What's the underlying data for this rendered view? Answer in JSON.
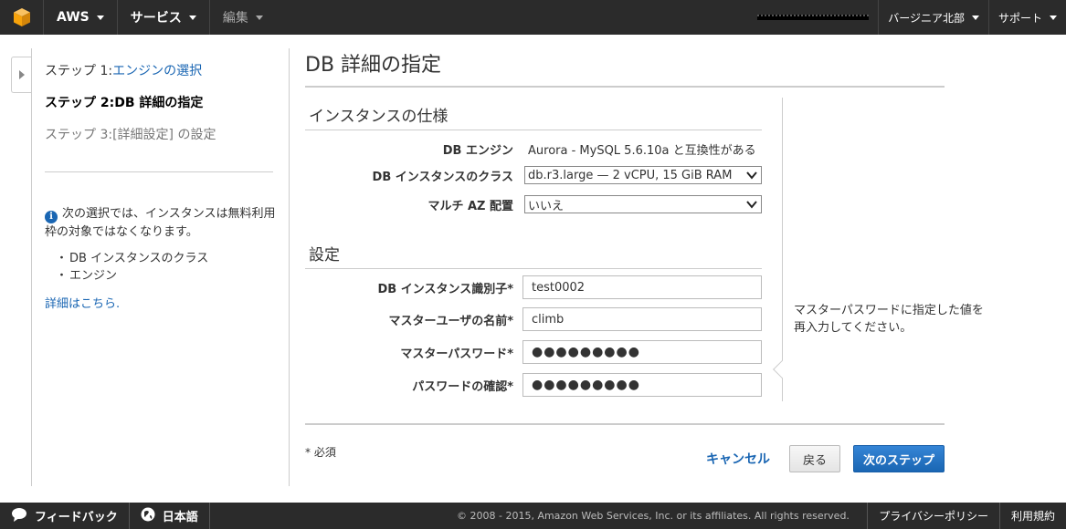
{
  "topnav": {
    "aws_label": "AWS",
    "services_label": "サービス",
    "edit_label": "編集",
    "region_label": "バージニア北部",
    "support_label": "サポート"
  },
  "wizard": {
    "step1_prefix": "ステップ 1:",
    "step1_link": "エンジンの選択",
    "step2": "ステップ 2:DB 詳細の指定",
    "step3": "ステップ 3:[詳細設定] の設定",
    "note_text": "次の選択では、インスタンスは無料利用枠の対象ではなくなります。",
    "note_items": [
      "DB インスタンスのクラス",
      "エンジン"
    ],
    "more_link": "詳細はこちら."
  },
  "page": {
    "title": "DB 詳細の指定",
    "section_spec": "インスタンスの仕様",
    "section_settings": "設定"
  },
  "form": {
    "engine_label": "DB エンジン",
    "engine_value": "Aurora - MySQL 5.6.10a と互換性がある",
    "class_label": "DB インスタンスのクラス",
    "class_value": "db.r3.large — 2 vCPU, 15 GiB RAM",
    "multiaz_label": "マルチ AZ 配置",
    "multiaz_value": "いいえ",
    "identifier_label": "DB インスタンス識別子*",
    "identifier_value": "test0002",
    "master_user_label": "マスターユーザの名前*",
    "master_user_value": "climb",
    "master_pw_label": "マスターパスワード*",
    "master_pw_value": "●●●●●●●●●",
    "confirm_pw_label": "パスワードの確認*",
    "confirm_pw_value": "●●●●●●●●●"
  },
  "help": {
    "text": "マスターパスワードに指定した値を再入力してください。"
  },
  "actions": {
    "required_note": "* 必須",
    "cancel": "キャンセル",
    "back": "戻る",
    "next": "次のステップ"
  },
  "footer": {
    "feedback": "フィードバック",
    "language": "日本語",
    "copyright": "© 2008 - 2015, Amazon Web Services, Inc. or its affiliates. All rights reserved.",
    "privacy": "プライバシーポリシー",
    "terms": "利用規約"
  },
  "colors": {
    "nav_bg": "#2b2b2b",
    "link": "#1a66b3",
    "primary_button": "#1a66b3",
    "logo_orange": "#f7a30b"
  }
}
